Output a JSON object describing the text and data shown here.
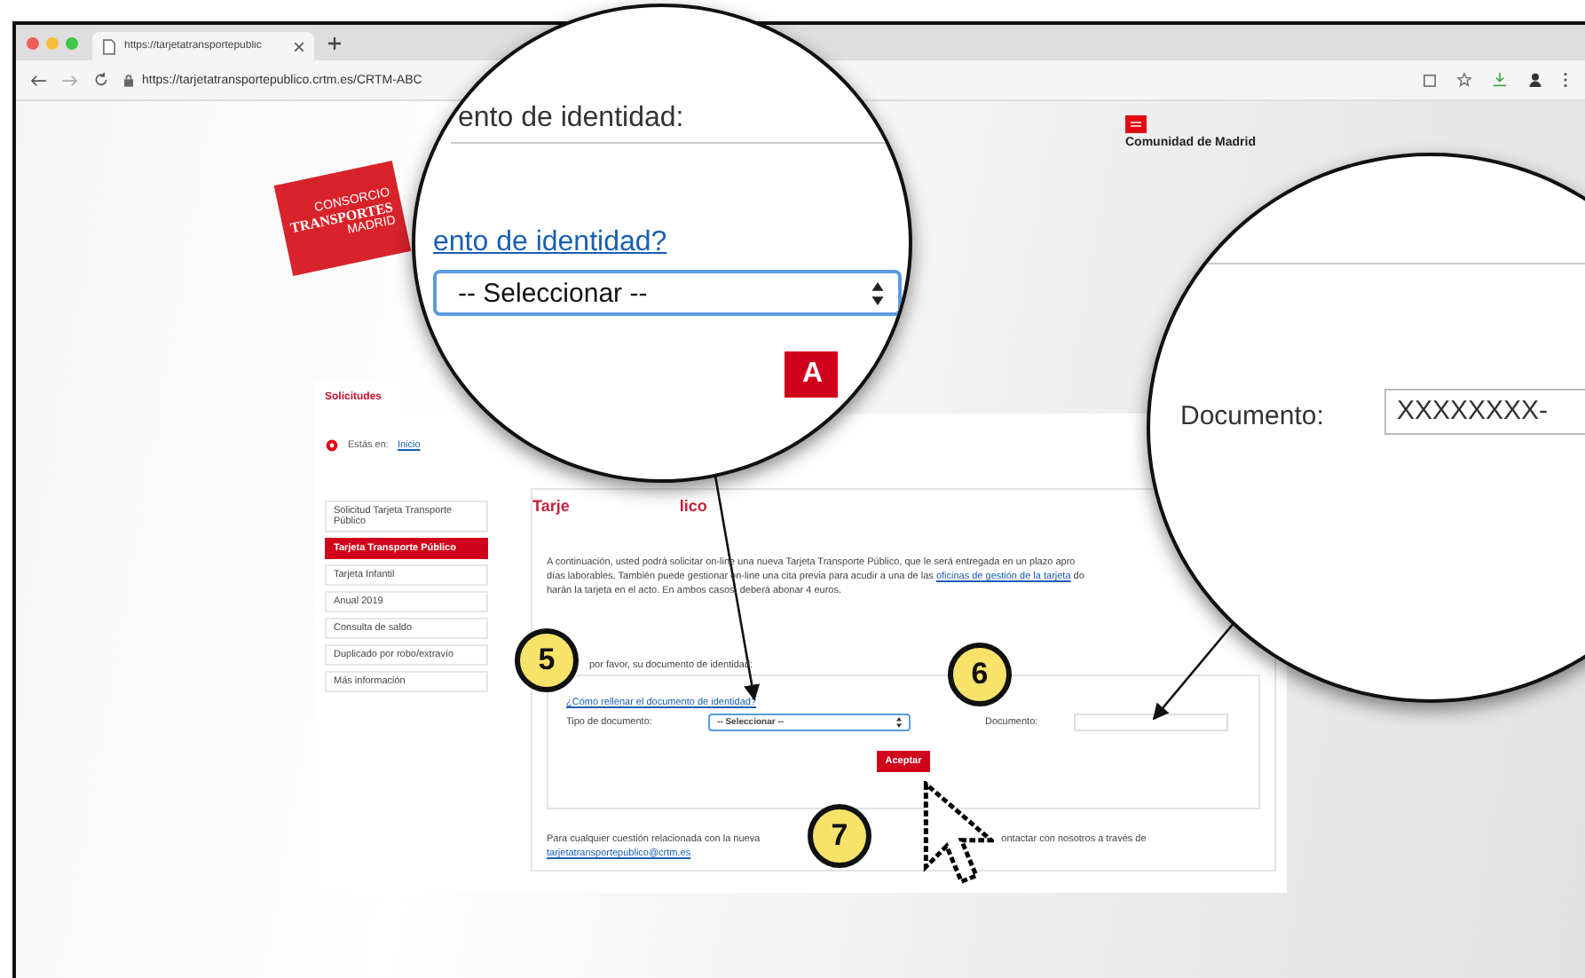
{
  "browser": {
    "tab_title": "https://tarjetatransportepublic",
    "url": "https://tarjetatransportepublico.crtm.es/CRTM-ABC"
  },
  "header": {
    "logo_lines": [
      "CONSORCIO",
      "TRANSPORTES",
      "MADRID"
    ],
    "region_name": "Comunidad de Madrid"
  },
  "section_tab": "Solicitudes",
  "breadcrumb": {
    "label": "Estás en:",
    "link": "Inicio"
  },
  "sidebar": {
    "items": [
      {
        "label": "Solicitud Tarjeta Transporte Público",
        "selected": false
      },
      {
        "label": "Tarjeta Transporte Público",
        "selected": true
      },
      {
        "label": "Tarjeta Infantil",
        "selected": false
      },
      {
        "label": "Anual 2019",
        "selected": false
      },
      {
        "label": "Consulta de saldo",
        "selected": false
      },
      {
        "label": "Duplicado por robo/extravío",
        "selected": false
      },
      {
        "label": "Más información",
        "selected": false
      }
    ]
  },
  "main": {
    "heading_parts": [
      "Tarje",
      "lico"
    ],
    "intro_lines": [
      {
        "text": "A continuación, usted podrá solicitar on-line una nueva Tarjeta Transporte Público, que le será entregada en un plazo apro"
      },
      {
        "text": "días laborables. También puede gestionar on-line una cita previa para acudir a una de las ",
        "link": "oficinas de gestión de la tarjeta",
        "after": " do"
      },
      {
        "text": "harán la tarjeta en el acto. En ambos casos, deberá abonar 4 euros."
      }
    ],
    "form_prompt": "por favor, su documento de identidad:",
    "help_link": "¿Cómo rellenar el documento de identidad?",
    "doc_type_label": "Tipo de documento:",
    "doc_type_value": "-- Seleccionar --",
    "doc_label": "Documento:",
    "submit": "Aceptar",
    "footer_start": "Para cualquier cuestión relacionada con la nueva",
    "footer_end": "ontactar con nosotros a través de",
    "footer_email": "tarjetatransportepublico@crtm.es"
  },
  "magnifier_left": {
    "label": "ento de identidad:",
    "link": "ento de identidad?",
    "select": "-- Seleccionar --",
    "button": "A"
  },
  "magnifier_right": {
    "label": "Documento:",
    "value": "XXXXXXXX-"
  },
  "badges": [
    "5",
    "6",
    "7"
  ]
}
